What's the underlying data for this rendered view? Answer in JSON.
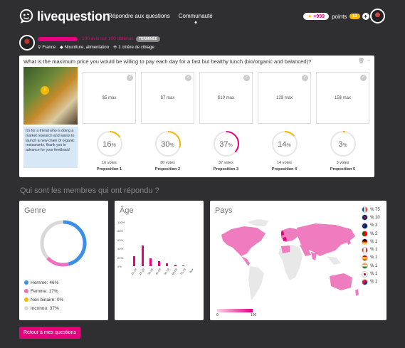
{
  "header": {
    "logo_text": "livequestion",
    "nav": [
      "Répondre aux questions",
      "Communauté"
    ],
    "points_value": "+999",
    "points_label": "points",
    "credits": "13"
  },
  "question_meta": {
    "reviews_text": "100 avis sur 100 obtenus",
    "status_badge": "TERMINÉE",
    "country": "France",
    "category": "Nourriture, alimentation",
    "criteria": "1 critère de ciblage",
    "progress": 1.0
  },
  "question": {
    "title": "What is the maximum price you would be willing to pay each day for a fast but healthy lunch (bio/organic and balanced)?",
    "note": "It's for a friend who is doing a market research and wants to launch a new chain of organic restaurants, thank you in advance for your feedback!",
    "options": [
      {
        "label": "$5 max",
        "percent": "16",
        "percent_value": 16,
        "votes": "16 votes",
        "prop": "Proposition 1",
        "color": "#f5b800"
      },
      {
        "label": "$7 max",
        "percent": "30",
        "percent_value": 30,
        "votes": "30 votes",
        "prop": "Proposition 2",
        "color": "#f5b800"
      },
      {
        "label": "$10 max",
        "percent": "37",
        "percent_value": 37,
        "votes": "37 votes",
        "prop": "Proposition 3",
        "color": "#e6007e"
      },
      {
        "label": "12$ max",
        "percent": "14",
        "percent_value": 14,
        "votes": "14 votes",
        "prop": "Proposition 4",
        "color": "#f5b800"
      },
      {
        "label": "15$ max",
        "percent": "3",
        "percent_value": 3,
        "votes": "3 votes",
        "prop": "Proposition 5",
        "color": "#f5b800"
      }
    ],
    "percent_sign": "%"
  },
  "members": {
    "title": "Qui sont les membres qui ont répondu ?",
    "genre": {
      "title": "Genre",
      "legend": [
        {
          "label": "Homme: 46%",
          "color": "#3b8fe6",
          "value": 46
        },
        {
          "label": "Femme: 17%",
          "color": "#f06fbf",
          "value": 17
        },
        {
          "label": "Non binaire: 0%",
          "color": "#f5b800",
          "value": 0
        },
        {
          "label": "Inconnu: 37%",
          "color": "#d9d9d9",
          "value": 37
        }
      ]
    },
    "age": {
      "title": "Âge",
      "yticks": [
        "100%",
        "80%",
        "60%",
        "40%",
        "20%",
        "0%"
      ],
      "categories": [
        "13-19",
        "20-29",
        "30-39",
        "40-49",
        "50-59",
        "60-69",
        "70-79",
        "80+"
      ],
      "values": [
        23,
        46,
        18,
        11,
        6,
        3,
        1,
        0
      ]
    },
    "pays": {
      "title": "Pays",
      "scale_min": "0",
      "scale_max": "100",
      "countries": [
        {
          "name": "France",
          "value": "% 75"
        },
        {
          "name": "United Kingdom",
          "value": "% 10"
        },
        {
          "name": "Australia",
          "value": "% 2"
        },
        {
          "name": "Portugal",
          "value": "% 2"
        },
        {
          "name": "Germany",
          "value": "% 1"
        },
        {
          "name": "Canada",
          "value": "% 1"
        },
        {
          "name": "Spain",
          "value": "% 1"
        },
        {
          "name": "India",
          "value": "% 1"
        },
        {
          "name": "Japan",
          "value": "% 1"
        },
        {
          "name": "Nepal",
          "value": "% 1"
        }
      ]
    }
  },
  "back_button": "Retour à mes questions"
}
